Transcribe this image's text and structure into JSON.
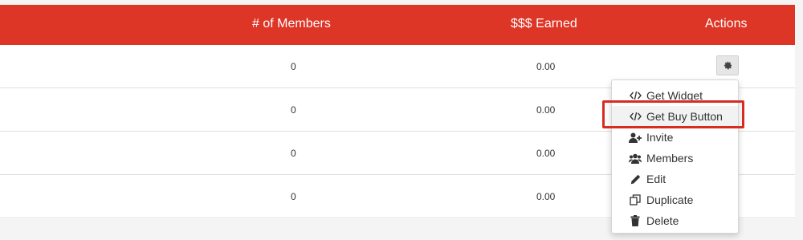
{
  "header": {
    "members_label": "# of Members",
    "earned_label": "$$$ Earned",
    "actions_label": "Actions"
  },
  "rows": [
    {
      "members": "0",
      "earned": "0.00"
    },
    {
      "members": "0",
      "earned": "0.00"
    },
    {
      "members": "0",
      "earned": "0.00"
    },
    {
      "members": "0",
      "earned": "0.00"
    }
  ],
  "actions_menu": {
    "items": [
      {
        "label": "Get Widget",
        "icon": "code-icon"
      },
      {
        "label": "Get Buy Button",
        "icon": "code-icon"
      },
      {
        "label": "Invite",
        "icon": "user-plus-icon"
      },
      {
        "label": "Members",
        "icon": "users-icon"
      },
      {
        "label": "Edit",
        "icon": "pencil-icon"
      },
      {
        "label": "Duplicate",
        "icon": "copy-icon"
      },
      {
        "label": "Delete",
        "icon": "trash-icon"
      }
    ],
    "highlighted_item": "Get Buy Button"
  },
  "colors": {
    "header_bg": "#dd3526",
    "highlight_border": "#d62c22"
  }
}
